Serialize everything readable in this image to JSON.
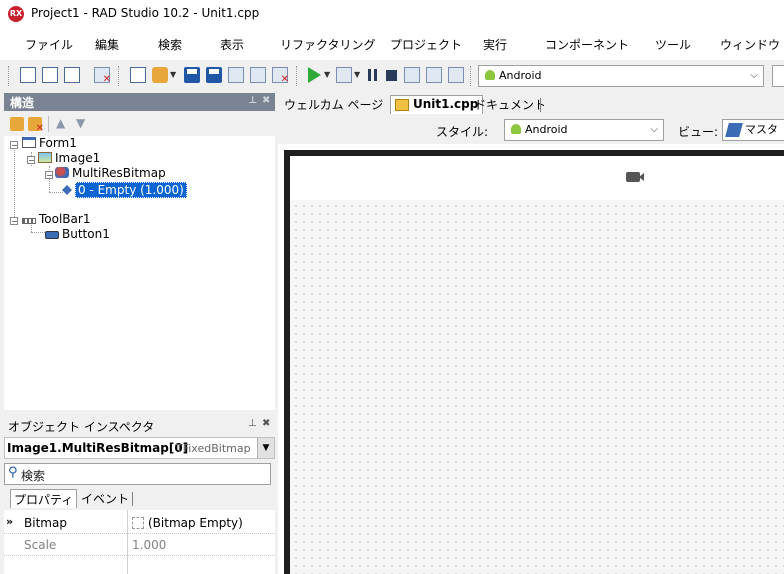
{
  "window": {
    "title": "Project1 - RAD Studio 10.2 - Unit1.cpp",
    "icon_text": "RX"
  },
  "menu": [
    "ファイル",
    "編集",
    "検索",
    "表示",
    "リファクタリング",
    "プロジェクト",
    "実行",
    "コンポーネント",
    "ツール",
    "ウィンドウ"
  ],
  "toolbar": {
    "platform_combo": "Android"
  },
  "structure": {
    "title": "構造",
    "tree": [
      {
        "label": "Form1"
      },
      {
        "label": "Image1"
      },
      {
        "label": "MultiResBitmap"
      },
      {
        "label": "0 - Empty (1.000)",
        "selected": true
      },
      {
        "label": "ToolBar1"
      },
      {
        "label": "Button1"
      }
    ]
  },
  "inspector": {
    "title": "オブジェクト インスペクタ",
    "object_name": "Image1.MultiResBitmap[0]",
    "object_type": "TFixedBitmap",
    "search_placeholder": "検索",
    "tabs": [
      "プロパティ",
      "イベント"
    ],
    "properties": [
      {
        "name": "Bitmap",
        "value": "(Bitmap Empty)"
      },
      {
        "name": "Scale",
        "value": "1.000"
      }
    ]
  },
  "editor": {
    "tabs": [
      "ウェルカム ページ",
      "Unit1.cpp",
      "ドキュメント"
    ],
    "style_label": "スタイル:",
    "style_value": "Android",
    "view_label": "ビュー:",
    "view_value": "マスタ"
  }
}
